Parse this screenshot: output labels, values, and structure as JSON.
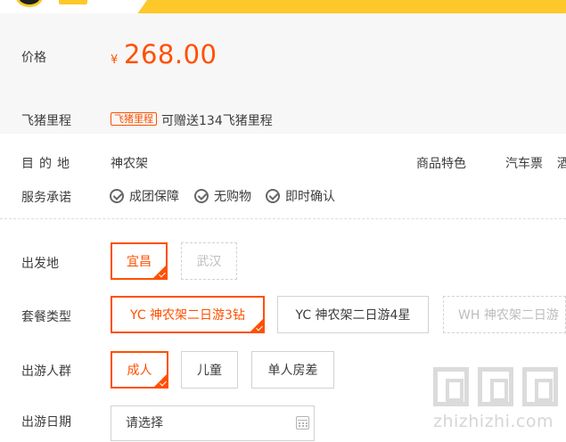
{
  "price": {
    "label": "价格",
    "currency": "¥",
    "amount": "268.00"
  },
  "mileage": {
    "label": "飞猪里程",
    "badge": "飞猪里程",
    "text": "可赠送134飞猪里程"
  },
  "destination": {
    "label": "目的地",
    "value": "神农架"
  },
  "features": {
    "label": "商品特色",
    "value": "汽车票",
    "value_cut": "酒"
  },
  "service": {
    "label": "服务承诺",
    "items": [
      "成团保障",
      "无购物",
      "即时确认"
    ]
  },
  "departure": {
    "label": "出发地",
    "options": [
      {
        "text": "宜昌",
        "state": "selected"
      },
      {
        "text": "武汉",
        "state": "disabled"
      }
    ]
  },
  "package": {
    "label": "套餐类型",
    "options": [
      {
        "text": "YC 神农架二日游3钻",
        "state": "selected"
      },
      {
        "text": "YC 神农架二日游4星",
        "state": "normal"
      },
      {
        "text": "WH 神农架二日游",
        "state": "disabled"
      }
    ]
  },
  "group": {
    "label": "出游人群",
    "options": [
      {
        "text": "成人",
        "state": "selected"
      },
      {
        "text": "儿童",
        "state": "normal"
      },
      {
        "text": "单人房差",
        "state": "normal"
      }
    ]
  },
  "date": {
    "label": "出游日期",
    "placeholder": "请选择"
  },
  "watermark": {
    "text": "zhizhizhi.com"
  },
  "colors": {
    "accent": "#ff5000",
    "brand_yellow": "#ffc82a",
    "row_bg": "#f7f7f7"
  },
  "icons": [
    "check-circle-icon",
    "calendar-icon",
    "selected-check-corner-icon"
  ]
}
